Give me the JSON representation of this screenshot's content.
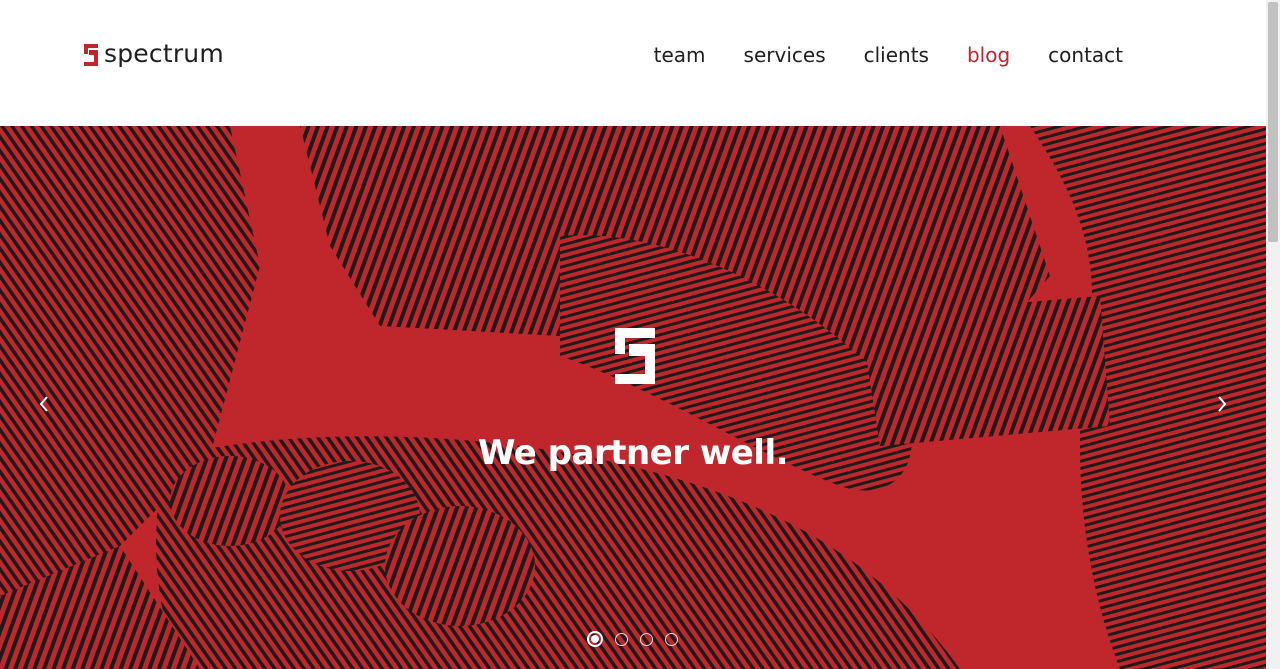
{
  "brand": {
    "name": "spectrum",
    "accent_color": "#c0272d",
    "logo_icon": "spectrum-logo-icon"
  },
  "nav": {
    "items": [
      {
        "label": "team",
        "active": false
      },
      {
        "label": "services",
        "active": false
      },
      {
        "label": "clients",
        "active": false
      },
      {
        "label": "blog",
        "active": true
      },
      {
        "label": "contact",
        "active": false
      }
    ]
  },
  "hero": {
    "headline": "We partner well.",
    "background_color": "#c0272d",
    "image_icon": "handshake-engraving-image",
    "center_icon": "spectrum-logo-icon",
    "prev_icon": "chevron-left-icon",
    "next_icon": "chevron-right-icon",
    "slides_total": 4,
    "active_slide": 1
  }
}
